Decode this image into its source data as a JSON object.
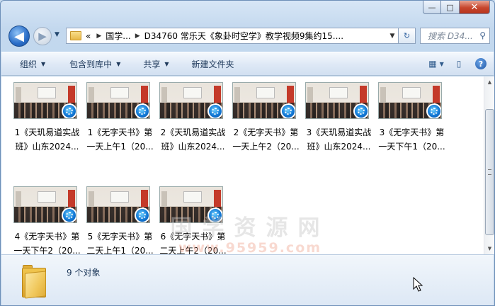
{
  "window": {
    "minimize_glyph": "—",
    "maximize_glyph": "□",
    "close_glyph": "✕"
  },
  "nav": {
    "back_glyph": "◀",
    "forward_glyph": "▶",
    "address_crumbs": [
      "«",
      "国学...",
      "D34760 常乐天《象卦时空学》教学视频9集约15...."
    ],
    "search_placeholder": "搜索 D34..."
  },
  "toolbar": {
    "organize": "组织",
    "include_library": "包含到库中",
    "share": "共享",
    "new_folder": "新建文件夹"
  },
  "files": [
    {
      "label_line1": "1《天玑易道实战",
      "label_line2": "班》山东2024..."
    },
    {
      "label_line1": "1《无字天书》第",
      "label_line2": "一天上午1（20..."
    },
    {
      "label_line1": "2《天玑易道实战",
      "label_line2": "班》山东2024..."
    },
    {
      "label_line1": "2《无字天书》第",
      "label_line2": "一天上午2（20..."
    },
    {
      "label_line1": "3《天玑易道实战",
      "label_line2": "班》山东2024..."
    },
    {
      "label_line1": "3《无字天书》第",
      "label_line2": "一天下午1（20..."
    },
    {
      "label_line1": "4《无字天书》第",
      "label_line2": "一天下午2（20..."
    },
    {
      "label_line1": "5《无字天书》第",
      "label_line2": "二天上午1（20..."
    },
    {
      "label_line1": "6《无字天书》第",
      "label_line2": "二天上午2（20..."
    }
  ],
  "watermark": {
    "line1": "国学资源网",
    "line2": "www.95959.com"
  },
  "status": {
    "count_text": "9 个对象"
  }
}
